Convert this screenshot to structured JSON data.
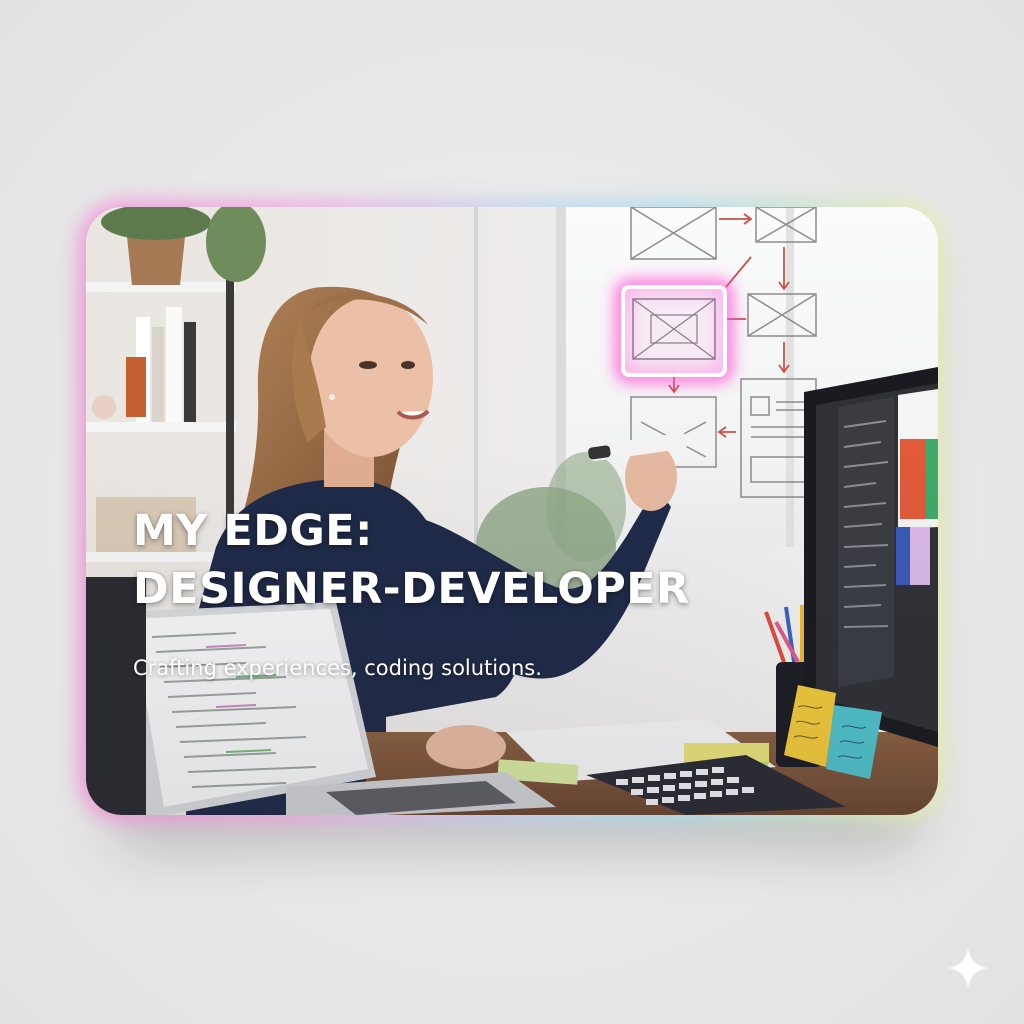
{
  "card": {
    "headline_line1": "MY EDGE:",
    "headline_line2": "DESIGNER-DEVELOPER",
    "subtitle": "Crafting experiences, coding solutions."
  },
  "colors": {
    "glow_pink": "#f28bd9",
    "glow_blue": "#a9e0ef",
    "glow_yellow": "#e9f0a8",
    "neon_frame": "#ff4fd8",
    "text": "#ffffff"
  },
  "icons": {
    "corner_sparkle": "sparkle-icon"
  }
}
